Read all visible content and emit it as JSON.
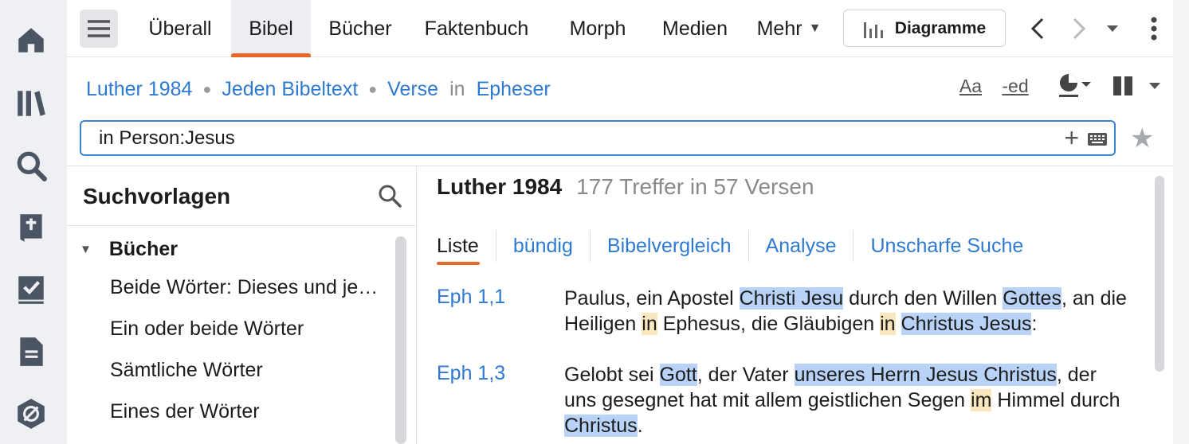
{
  "rail": {
    "icons": [
      "home-icon",
      "library-icon",
      "search-icon",
      "bible-icon",
      "checklist-icon",
      "document-icon",
      "guides-icon"
    ]
  },
  "tabs": [
    {
      "label": "Überall"
    },
    {
      "label": "Bibel",
      "active": true
    },
    {
      "label": "Bücher"
    },
    {
      "label": "Faktenbuch"
    },
    {
      "label": "Morph"
    },
    {
      "label": "Medien"
    },
    {
      "label": "Mehr"
    }
  ],
  "toolbar": {
    "diagrams_label": "Diagramme"
  },
  "breadcrumb": {
    "resource": "Luther 1984",
    "scope": "Jeden Bibeltext",
    "unit": "Verse",
    "in": "in",
    "range": "Epheser"
  },
  "tools": {
    "font_label": "Aa",
    "ed_label": "-ed"
  },
  "search": {
    "value": "in Person:Jesus"
  },
  "left_panel": {
    "title": "Suchvorlagen",
    "group": "Bücher",
    "items": [
      "Beide Wörter: Dieses und jenes",
      "Ein oder beide Wörter",
      "Sämtliche Wörter",
      "Eines der Wörter"
    ]
  },
  "results": {
    "title": "Luther 1984",
    "count": "177 Treffer in 57 Versen",
    "view_tabs": [
      "Liste",
      "bündig",
      "Bibelvergleich",
      "Analyse",
      "Unscharfe Suche"
    ],
    "verses": [
      {
        "ref": "Eph 1,1",
        "segments": [
          {
            "t": "Paulus, ein Apostel ",
            "h": ""
          },
          {
            "t": "Christi Jesu",
            "h": "b"
          },
          {
            "t": " durch den Willen ",
            "h": ""
          },
          {
            "t": "Gottes",
            "h": "b"
          },
          {
            "t": ", an die Heiligen ",
            "h": ""
          },
          {
            "t": "in",
            "h": "y"
          },
          {
            "t": " Ephesus, die Gläubigen ",
            "h": ""
          },
          {
            "t": "in",
            "h": "y"
          },
          {
            "t": " ",
            "h": ""
          },
          {
            "t": "Christus Jesus",
            "h": "b"
          },
          {
            "t": ":",
            "h": ""
          }
        ]
      },
      {
        "ref": "Eph 1,3",
        "segments": [
          {
            "t": "Gelobt sei ",
            "h": ""
          },
          {
            "t": "Gott",
            "h": "b"
          },
          {
            "t": ", der Vater ",
            "h": ""
          },
          {
            "t": "unseres Herrn Jesus Christus",
            "h": "b"
          },
          {
            "t": ", der uns gesegnet hat mit allem geistlichen Segen ",
            "h": ""
          },
          {
            "t": "im",
            "h": "y"
          },
          {
            "t": " Himmel durch ",
            "h": ""
          },
          {
            "t": "Christus",
            "h": "b"
          },
          {
            "t": ".",
            "h": ""
          }
        ]
      }
    ]
  },
  "colors": {
    "accent": "#e8682c",
    "link": "#2f7ad1",
    "highlight_blue": "#b8d3f7",
    "highlight_yellow": "#fbe7bd"
  }
}
